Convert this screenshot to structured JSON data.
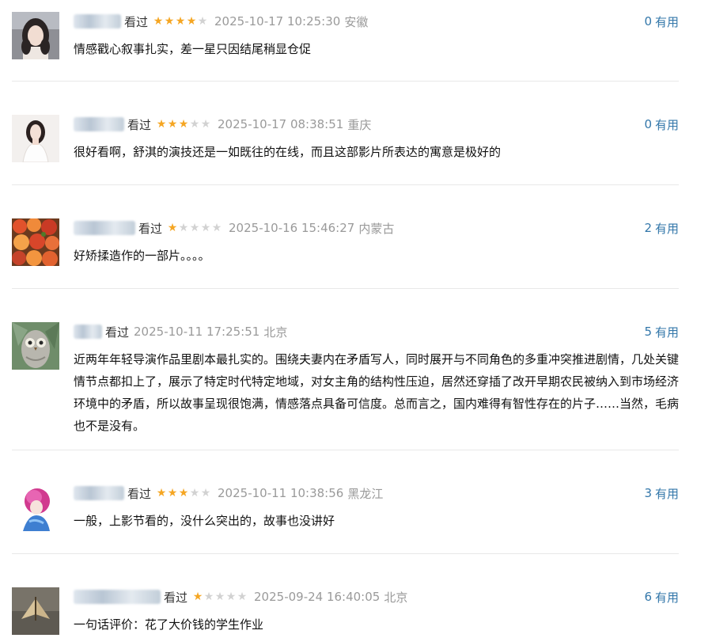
{
  "comments": [
    {
      "status": "看过",
      "rating": 4,
      "time": "2025-10-17 10:25:30",
      "location": "安徽",
      "useful_count": "0",
      "useful_label": "有用",
      "text": "情感戳心叙事扎实，差一星只因结尾稍显仓促",
      "avatar": "avatar-photo-girl"
    },
    {
      "status": "看过",
      "rating": 3,
      "time": "2025-10-17 08:38:51",
      "location": "重庆",
      "useful_count": "0",
      "useful_label": "有用",
      "text": "很好看啊，舒淇的演技还是一如既往的在线，而且这部影片所表达的寓意是极好的",
      "avatar": "avatar-photo-woman-white"
    },
    {
      "status": "看过",
      "rating": 1,
      "time": "2025-10-16 15:46:27",
      "location": "内蒙古",
      "useful_count": "2",
      "useful_label": "有用",
      "text": "好矫揉造作的一部片。。。。",
      "avatar": "avatar-photo-fruit"
    },
    {
      "status": "看过",
      "rating": 0,
      "time": "2025-10-11 17:25:51",
      "location": "北京",
      "useful_count": "5",
      "useful_label": "有用",
      "text": "近两年年轻导演作品里剧本最扎实的。围绕夫妻内在矛盾写人，同时展开与不同角色的多重冲突推进剧情，几处关键情节点都扣上了，展示了特定时代特定地域，对女主角的结构性压迫，居然还穿插了改开早期农民被纳入到市场经济环境中的矛盾，所以故事呈现很饱满，情感落点具备可信度。总而言之，国内难得有智性存在的片子……当然，毛病也不是没有。",
      "avatar": "avatar-illustration-owl"
    },
    {
      "status": "看过",
      "rating": 3,
      "time": "2025-10-11 10:38:56",
      "location": "黑龙江",
      "useful_count": "3",
      "useful_label": "有用",
      "text": "一般，上影节看的，没什么突出的，故事也没讲好",
      "avatar": "avatar-illustration-pink-hair"
    },
    {
      "status": "看过",
      "rating": 1,
      "time": "2025-09-24 16:40:05",
      "location": "北京",
      "useful_count": "6",
      "useful_label": "有用",
      "text": "一句话评价：花了大价钱的学生作业",
      "avatar": "avatar-photo-moth"
    }
  ],
  "colors": {
    "star_on": "#f5a623",
    "star_off": "#d2d2d2",
    "useful_link": "#3377aa",
    "meta_gray": "#9a9a9a"
  }
}
